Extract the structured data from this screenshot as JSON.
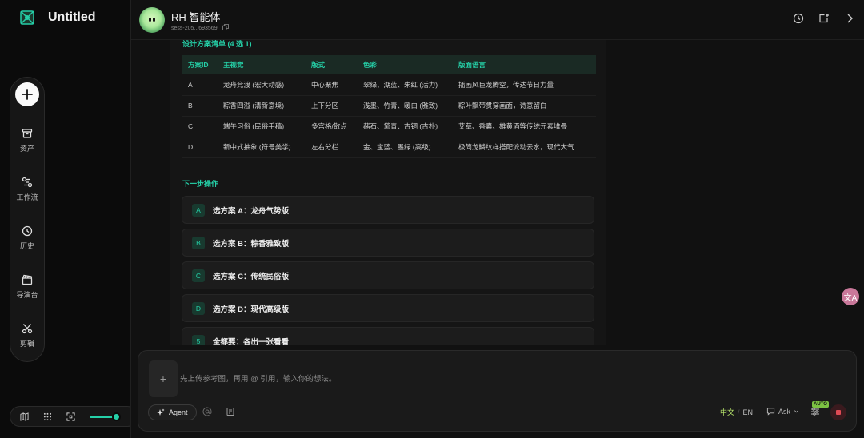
{
  "app": {
    "title": "Untitled"
  },
  "toolbar": {
    "items": [
      {
        "label": "资产",
        "icon": "box-icon"
      },
      {
        "label": "工作流",
        "icon": "workflow-icon"
      },
      {
        "label": "历史",
        "icon": "clock-icon"
      },
      {
        "label": "导演台",
        "icon": "clapperboard-icon"
      },
      {
        "label": "剪辑",
        "icon": "scissors-icon"
      }
    ]
  },
  "header": {
    "agent_name": "RH 智能体",
    "session_id": "sess-205...693569"
  },
  "plan": {
    "title": "设计方案清单 (4 选 1)",
    "columns": [
      "方案ID",
      "主视觉",
      "版式",
      "色彩",
      "版面语言"
    ],
    "rows": [
      [
        "A",
        "龙舟竞渡 (宏大动感)",
        "中心聚焦",
        "翠绿、湖蓝、朱红 (活力)",
        "插画风巨龙腾空，传达节日力量"
      ],
      [
        "B",
        "粽香四溢 (清新意境)",
        "上下分区",
        "浅墨、竹青、暖白 (雅致)",
        "粽叶飘带贯穿画面，诗意留白"
      ],
      [
        "C",
        "端午习俗 (民俗手稿)",
        "多宫格/散点",
        "赭石、黛青、古铜 (古朴)",
        "艾草、香囊、雄黄酒等传统元素堆叠"
      ],
      [
        "D",
        "新中式抽象 (符号美学)",
        "左右分栏",
        "金、宝蓝、墨绿 (高级)",
        "极简龙鳞纹样搭配流动云水，现代大气"
      ]
    ]
  },
  "next_steps": {
    "title": "下一步操作",
    "options": [
      {
        "key": "A",
        "label": "选方案 A：龙舟气势版"
      },
      {
        "key": "B",
        "label": "选方案 B：粽香雅致版"
      },
      {
        "key": "C",
        "label": "选方案 C：传统民俗版"
      },
      {
        "key": "D",
        "label": "选方案 D：现代高级版"
      },
      {
        "key": "5",
        "label": "全都要：各出一张看看"
      }
    ]
  },
  "composer": {
    "placeholder": "先上传参考图，再用 @ 引用，输入你的想法。",
    "agent_label": "Agent",
    "lang_zh": "中文",
    "lang_en": "EN",
    "mode_label": "Ask",
    "auto_badge": "AUTO"
  },
  "float_badge": "文A",
  "colors": {
    "accent": "#25d0a8",
    "lang_active": "#b6e36b",
    "stop": "#e14b55"
  }
}
